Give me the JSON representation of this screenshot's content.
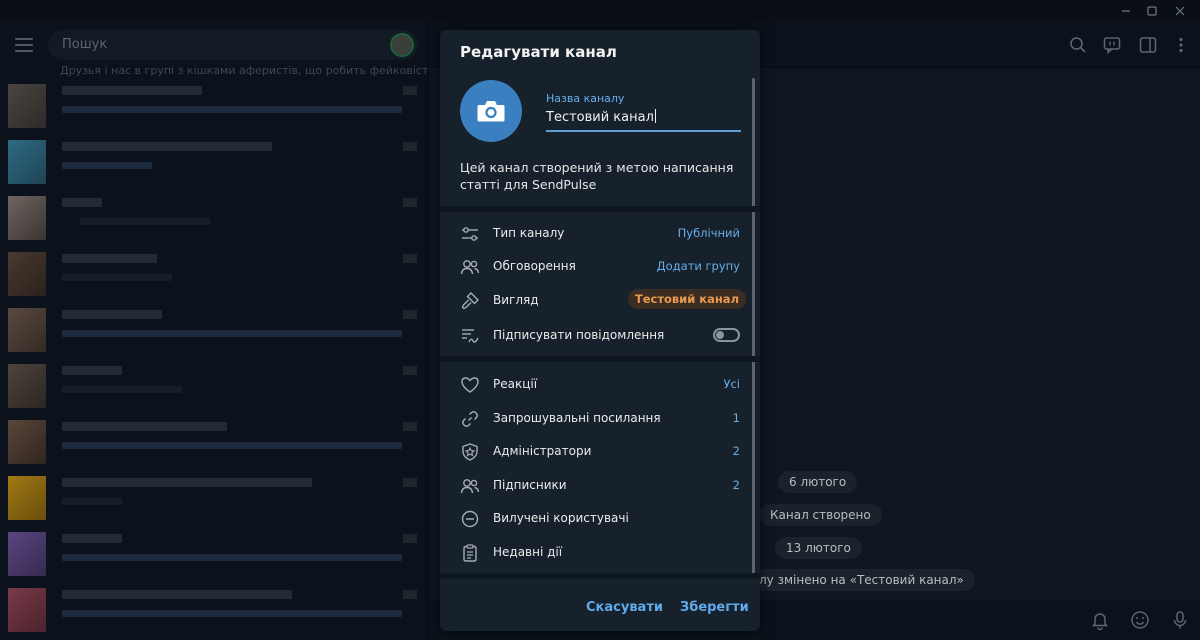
{
  "window": {
    "minimize_icon": "minimize-icon",
    "maximize_icon": "maximize-icon",
    "close_icon": "close-icon"
  },
  "left_panel": {
    "search_placeholder": "Пошук",
    "first_message_preview": "Друзья і нас в групі з кішками аферистів, що робить фейковість..."
  },
  "right_panel": {
    "header_icons": [
      "search-icon",
      "chat-bubble-icon",
      "sidebar-icon",
      "more-vertical-icon"
    ],
    "service_messages": [
      "6 лютого",
      "Канал створено",
      "13 лютого",
      "лу змінено на «Тестовий канал»"
    ],
    "bottom_icons": [
      "bell-icon",
      "emoji-icon",
      "microphone-icon"
    ]
  },
  "dialog": {
    "title": "Редагувати канал",
    "name_field": {
      "label": "Назва каналу",
      "value": "Тестовий канал"
    },
    "description": "Цей канал створений з метою написання статті для SendPulse",
    "settings": [
      {
        "icon": "sliders-icon",
        "label": "Тип каналу",
        "value": "Публічний"
      },
      {
        "icon": "discussion-icon",
        "label": "Обговорення",
        "value": "Додати групу"
      },
      {
        "icon": "brush-icon",
        "label": "Вигляд",
        "value": "Тестовий канал"
      },
      {
        "icon": "signature-icon",
        "label": "Підписувати повідомлення",
        "toggle": false
      }
    ],
    "management": [
      {
        "icon": "heart-icon",
        "label": "Реакції",
        "value": "Усі"
      },
      {
        "icon": "link-icon",
        "label": "Запрошувальні посилання",
        "value": "1"
      },
      {
        "icon": "admin-shield-icon",
        "label": "Адміністратори",
        "value": "2"
      },
      {
        "icon": "subscribers-icon",
        "label": "Підписники",
        "value": "2"
      },
      {
        "icon": "minus-circle-icon",
        "label": "Вилучені користувачі",
        "value": ""
      },
      {
        "icon": "clipboard-icon",
        "label": "Недавні дії",
        "value": ""
      }
    ],
    "cancel_label": "Скасувати",
    "save_label": "Зберегти"
  },
  "colors": {
    "accent": "#5eaaeb",
    "avatar_blue": "#3a7fbf",
    "chip_orange": "#e89a4f",
    "dialog_bg": "#17212b"
  }
}
